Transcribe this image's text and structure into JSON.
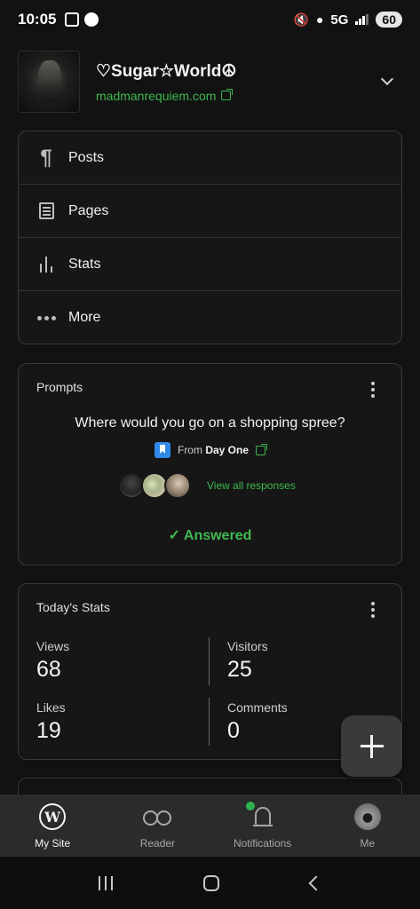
{
  "status_bar": {
    "time": "10:05",
    "network": "5G",
    "battery": "60"
  },
  "site": {
    "title": "♡Sugar☆World☮",
    "url": "madmanrequiem.com"
  },
  "menu": [
    {
      "label": "Posts",
      "icon": "pilcrow-icon"
    },
    {
      "label": "Pages",
      "icon": "page-icon"
    },
    {
      "label": "Stats",
      "icon": "stats-icon"
    },
    {
      "label": "More",
      "icon": "more-dots-icon"
    }
  ],
  "prompts": {
    "heading": "Prompts",
    "question": "Where would you go on a shopping spree?",
    "from_prefix": "From",
    "from_source": "Day One",
    "view_all": "View all responses",
    "answered": "✓ Answered"
  },
  "stats": {
    "heading": "Today's Stats",
    "views_label": "Views",
    "views_value": "68",
    "visitors_label": "Visitors",
    "visitors_value": "25",
    "likes_label": "Likes",
    "likes_value": "19",
    "comments_label": "Comments",
    "comments_value": "0"
  },
  "bottom_nav": {
    "my_site": "My Site",
    "reader": "Reader",
    "notifications": "Notifications",
    "me": "Me"
  },
  "colors": {
    "accent_green": "#3fb950",
    "background": "#121212"
  }
}
